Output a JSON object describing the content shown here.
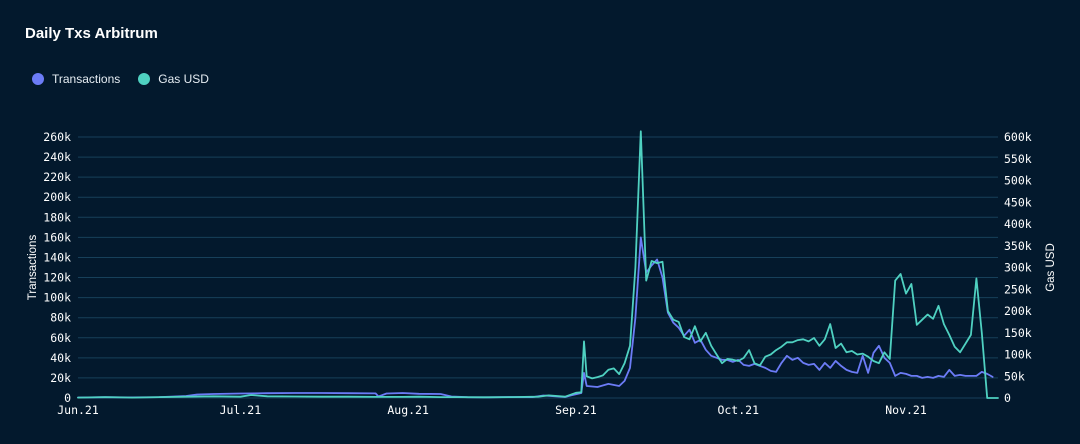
{
  "header": {
    "title": "Daily Txs Arbitrum"
  },
  "legend": [
    {
      "label": "Transactions",
      "color": "#6c7cf7"
    },
    {
      "label": "Gas USD",
      "color": "#4fd1c1"
    }
  ],
  "chart_data": {
    "type": "line",
    "title": "Daily Txs Arbitrum",
    "x_ticks": [
      "Jun.21",
      "Jul.21",
      "Aug.21",
      "Sep.21",
      "Oct.21",
      "Nov.21"
    ],
    "x_tick_days": [
      0,
      30,
      61,
      92,
      122,
      153
    ],
    "x_range": [
      0,
      170
    ],
    "y_left": {
      "label": "Transactions",
      "min": 0,
      "max": 260000,
      "ticks": [
        "0",
        "20k",
        "40k",
        "60k",
        "80k",
        "100k",
        "120k",
        "140k",
        "160k",
        "180k",
        "200k",
        "220k",
        "240k",
        "260k"
      ]
    },
    "y_right": {
      "label": "Gas USD",
      "min": 0,
      "max": 600000,
      "ticks": [
        "0",
        "50k",
        "100k",
        "150k",
        "200k",
        "250k",
        "300k",
        "350k",
        "400k",
        "450k",
        "500k",
        "550k",
        "600k"
      ]
    },
    "grid": true,
    "legend_position": "top-left",
    "series": [
      {
        "name": "Transactions",
        "axis": "left",
        "color": "#6c7cf7",
        "points": [
          [
            0,
            500
          ],
          [
            5,
            800
          ],
          [
            10,
            600
          ],
          [
            15,
            900
          ],
          [
            20,
            2000
          ],
          [
            22,
            3500
          ],
          [
            25,
            4000
          ],
          [
            30,
            4500
          ],
          [
            35,
            4800
          ],
          [
            40,
            5000
          ],
          [
            45,
            5000
          ],
          [
            50,
            4800
          ],
          [
            55,
            4600
          ],
          [
            55.5,
            1500
          ],
          [
            57,
            4500
          ],
          [
            60,
            5000
          ],
          [
            63,
            4200
          ],
          [
            67,
            4000
          ],
          [
            69,
            1500
          ],
          [
            72,
            800
          ],
          [
            76,
            700
          ],
          [
            80,
            1000
          ],
          [
            84,
            900
          ],
          [
            86,
            2500
          ],
          [
            88,
            1800
          ],
          [
            90,
            1000
          ],
          [
            91,
            2500
          ],
          [
            93,
            5000
          ],
          [
            93.5,
            25000
          ],
          [
            94,
            12000
          ],
          [
            96,
            11000
          ],
          [
            98,
            14000
          ],
          [
            100,
            12000
          ],
          [
            101,
            17000
          ],
          [
            102,
            30000
          ],
          [
            103,
            80000
          ],
          [
            104,
            160000
          ],
          [
            105,
            125000
          ],
          [
            106,
            132000
          ],
          [
            107,
            138000
          ],
          [
            108,
            120000
          ],
          [
            109,
            85000
          ],
          [
            110,
            75000
          ],
          [
            111,
            70000
          ],
          [
            112,
            62000
          ],
          [
            113,
            68000
          ],
          [
            114,
            55000
          ],
          [
            115,
            58000
          ],
          [
            116,
            48000
          ],
          [
            117,
            42000
          ],
          [
            118,
            40000
          ],
          [
            119,
            38000
          ],
          [
            120,
            38000
          ],
          [
            121,
            36000
          ],
          [
            122,
            38000
          ],
          [
            123,
            33000
          ],
          [
            124,
            32000
          ],
          [
            125,
            34000
          ],
          [
            126,
            32000
          ],
          [
            127,
            30000
          ],
          [
            128,
            27000
          ],
          [
            129,
            26000
          ],
          [
            130,
            35000
          ],
          [
            131,
            42000
          ],
          [
            132,
            38000
          ],
          [
            133,
            40000
          ],
          [
            134,
            35000
          ],
          [
            135,
            33000
          ],
          [
            136,
            34000
          ],
          [
            137,
            28000
          ],
          [
            138,
            35000
          ],
          [
            139,
            30000
          ],
          [
            140,
            37000
          ],
          [
            141,
            32000
          ],
          [
            142,
            28000
          ],
          [
            143,
            26000
          ],
          [
            144,
            25000
          ],
          [
            145,
            42000
          ],
          [
            146,
            25000
          ],
          [
            147,
            45000
          ],
          [
            148,
            52000
          ],
          [
            149,
            40000
          ],
          [
            150,
            35000
          ],
          [
            151,
            22000
          ],
          [
            152,
            25000
          ],
          [
            153,
            24000
          ],
          [
            154,
            22000
          ],
          [
            155,
            22000
          ],
          [
            156,
            20000
          ],
          [
            157,
            21000
          ],
          [
            158,
            20000
          ],
          [
            159,
            22000
          ],
          [
            160,
            21000
          ],
          [
            161,
            28000
          ],
          [
            162,
            22000
          ],
          [
            163,
            23000
          ],
          [
            164,
            22000
          ],
          [
            165,
            22000
          ],
          [
            166,
            22000
          ],
          [
            167,
            26000
          ],
          [
            168,
            24000
          ],
          [
            169,
            21000
          ]
        ]
      },
      {
        "name": "Gas USD",
        "axis": "right",
        "color": "#4fd1c1",
        "points": [
          [
            0,
            1000
          ],
          [
            5,
            2000
          ],
          [
            10,
            1000
          ],
          [
            15,
            2000
          ],
          [
            20,
            3000
          ],
          [
            25,
            4000
          ],
          [
            30,
            3000
          ],
          [
            32,
            7000
          ],
          [
            35,
            4000
          ],
          [
            40,
            3500
          ],
          [
            45,
            3000
          ],
          [
            50,
            3000
          ],
          [
            55,
            2500
          ],
          [
            60,
            2500
          ],
          [
            63,
            3000
          ],
          [
            67,
            2000
          ],
          [
            70,
            2000
          ],
          [
            75,
            1500
          ],
          [
            80,
            2000
          ],
          [
            85,
            3000
          ],
          [
            87,
            6000
          ],
          [
            90,
            3000
          ],
          [
            92,
            12000
          ],
          [
            93,
            13000
          ],
          [
            93.5,
            130000
          ],
          [
            94,
            50000
          ],
          [
            95,
            45000
          ],
          [
            96,
            48000
          ],
          [
            97,
            52000
          ],
          [
            98,
            65000
          ],
          [
            99,
            68000
          ],
          [
            100,
            55000
          ],
          [
            101,
            80000
          ],
          [
            102,
            120000
          ],
          [
            103,
            300000
          ],
          [
            104,
            613000
          ],
          [
            105,
            270000
          ],
          [
            106,
            315000
          ],
          [
            107,
            310000
          ],
          [
            108,
            313000
          ],
          [
            109,
            200000
          ],
          [
            110,
            180000
          ],
          [
            111,
            175000
          ],
          [
            112,
            140000
          ],
          [
            113,
            135000
          ],
          [
            114,
            165000
          ],
          [
            115,
            130000
          ],
          [
            116,
            150000
          ],
          [
            117,
            120000
          ],
          [
            118,
            100000
          ],
          [
            119,
            80000
          ],
          [
            120,
            90000
          ],
          [
            121,
            88000
          ],
          [
            122,
            85000
          ],
          [
            123,
            92000
          ],
          [
            124,
            110000
          ],
          [
            125,
            80000
          ],
          [
            126,
            75000
          ],
          [
            127,
            95000
          ],
          [
            128,
            100000
          ],
          [
            129,
            110000
          ],
          [
            130,
            118000
          ],
          [
            131,
            128000
          ],
          [
            132,
            128000
          ],
          [
            133,
            133000
          ],
          [
            134,
            135000
          ],
          [
            135,
            130000
          ],
          [
            136,
            138000
          ],
          [
            137,
            120000
          ],
          [
            138,
            135000
          ],
          [
            139,
            170000
          ],
          [
            140,
            115000
          ],
          [
            141,
            125000
          ],
          [
            142,
            105000
          ],
          [
            143,
            108000
          ],
          [
            144,
            100000
          ],
          [
            145,
            102000
          ],
          [
            146,
            95000
          ],
          [
            147,
            85000
          ],
          [
            148,
            80000
          ],
          [
            149,
            105000
          ],
          [
            150,
            90000
          ],
          [
            151,
            270000
          ],
          [
            152,
            285000
          ],
          [
            153,
            240000
          ],
          [
            154,
            262000
          ],
          [
            155,
            168000
          ],
          [
            156,
            180000
          ],
          [
            157,
            192000
          ],
          [
            158,
            182000
          ],
          [
            159,
            212000
          ],
          [
            160,
            170000
          ],
          [
            161,
            145000
          ],
          [
            162,
            118000
          ],
          [
            163,
            105000
          ],
          [
            164,
            125000
          ],
          [
            165,
            145000
          ],
          [
            166,
            275000
          ],
          [
            167,
            150000
          ],
          [
            168,
            0
          ],
          [
            169,
            0
          ],
          [
            170,
            0
          ]
        ]
      }
    ]
  }
}
